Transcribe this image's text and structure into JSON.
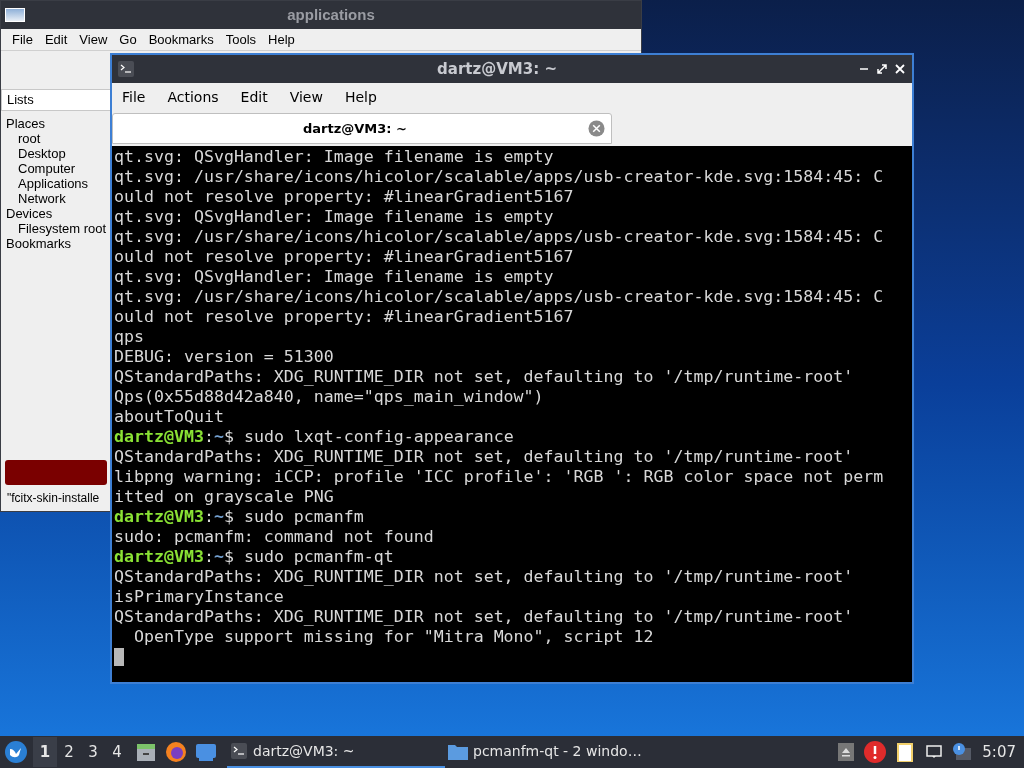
{
  "back_window": {
    "title": "applications",
    "menu": [
      "File",
      "Edit",
      "View",
      "Go",
      "Bookmarks",
      "Tools",
      "Help"
    ],
    "side_header": "Lists",
    "tree": [
      {
        "label": "Places",
        "children": [
          {
            "label": "root"
          },
          {
            "label": "Desktop"
          },
          {
            "label": "Computer"
          },
          {
            "label": "Applications"
          },
          {
            "label": "Network"
          }
        ]
      },
      {
        "label": "Devices",
        "children": [
          {
            "label": "Filesystem root"
          }
        ]
      },
      {
        "label": "Bookmarks"
      }
    ],
    "status_text": "\"fcitx-skin-installe"
  },
  "terminal": {
    "title": "dartz@VM3: ~",
    "menu": [
      "File",
      "Actions",
      "Edit",
      "View",
      "Help"
    ],
    "tabs": [
      {
        "label": "dartz@VM3: ~",
        "selected": true
      }
    ],
    "lines": [
      {
        "kind": "output",
        "text": "qt.svg: QSvgHandler: Image filename is empty"
      },
      {
        "kind": "output",
        "text": "qt.svg: /usr/share/icons/hicolor/scalable/apps/usb-creator-kde.svg:1584:45: C"
      },
      {
        "kind": "output",
        "text": "ould not resolve property: #linearGradient5167"
      },
      {
        "kind": "output",
        "text": "qt.svg: QSvgHandler: Image filename is empty"
      },
      {
        "kind": "output",
        "text": "qt.svg: /usr/share/icons/hicolor/scalable/apps/usb-creator-kde.svg:1584:45: C"
      },
      {
        "kind": "output",
        "text": "ould not resolve property: #linearGradient5167"
      },
      {
        "kind": "output",
        "text": "qt.svg: QSvgHandler: Image filename is empty"
      },
      {
        "kind": "output",
        "text": "qt.svg: /usr/share/icons/hicolor/scalable/apps/usb-creator-kde.svg:1584:45: C"
      },
      {
        "kind": "output",
        "text": "ould not resolve property: #linearGradient5167"
      },
      {
        "kind": "output",
        "text": "qps"
      },
      {
        "kind": "output",
        "text": "DEBUG: version = 51300"
      },
      {
        "kind": "output",
        "text": "QStandardPaths: XDG_RUNTIME_DIR not set, defaulting to '/tmp/runtime-root'"
      },
      {
        "kind": "output",
        "text": "Qps(0x55d88d42a840, name=\"qps_main_window\")"
      },
      {
        "kind": "output",
        "text": "aboutToQuit"
      },
      {
        "kind": "prompt",
        "user": "dartz@VM3",
        "sep": ":",
        "path": "~",
        "symbol": "$",
        "text": "sudo lxqt-config-appearance"
      },
      {
        "kind": "output",
        "text": "QStandardPaths: XDG_RUNTIME_DIR not set, defaulting to '/tmp/runtime-root'"
      },
      {
        "kind": "output",
        "text": "libpng warning: iCCP: profile 'ICC profile': 'RGB ': RGB color space not perm"
      },
      {
        "kind": "output",
        "text": "itted on grayscale PNG"
      },
      {
        "kind": "prompt",
        "user": "dartz@VM3",
        "sep": ":",
        "path": "~",
        "symbol": "$",
        "text": "sudo pcmanfm"
      },
      {
        "kind": "output",
        "text": "sudo: pcmanfm: command not found"
      },
      {
        "kind": "prompt",
        "user": "dartz@VM3",
        "sep": ":",
        "path": "~",
        "symbol": "$",
        "text": "sudo pcmanfm-qt"
      },
      {
        "kind": "output",
        "text": "QStandardPaths: XDG_RUNTIME_DIR not set, defaulting to '/tmp/runtime-root'"
      },
      {
        "kind": "output",
        "text": "isPrimaryInstance"
      },
      {
        "kind": "output",
        "text": "QStandardPaths: XDG_RUNTIME_DIR not set, defaulting to '/tmp/runtime-root'"
      },
      {
        "kind": "output",
        "text": "  OpenType support missing for \"Mitra Mono\", script 12"
      },
      {
        "kind": "cursor"
      }
    ]
  },
  "taskbar": {
    "desktops": [
      {
        "label": "1",
        "selected": true
      },
      {
        "label": "2",
        "selected": false
      },
      {
        "label": "3",
        "selected": false
      },
      {
        "label": "4",
        "selected": false
      }
    ],
    "tasks": [
      {
        "label": "dartz@VM3: ~",
        "kind": "terminal",
        "selected": true
      },
      {
        "label": "pcmanfm-qt - 2 windo…",
        "kind": "folder",
        "selected": false
      }
    ],
    "clock": "5:07"
  }
}
